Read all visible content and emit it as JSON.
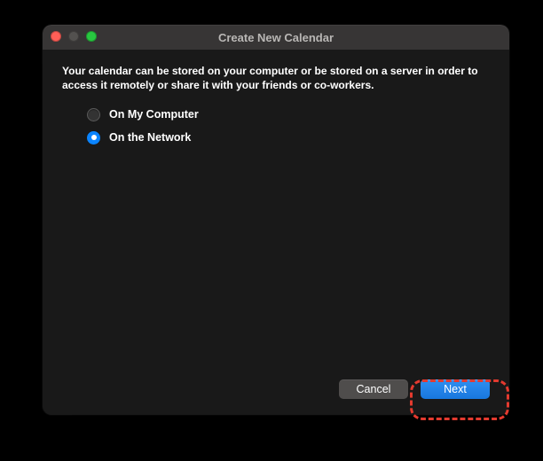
{
  "window": {
    "title": "Create New Calendar"
  },
  "intro": "Your calendar can be stored on your computer or be stored on a server in order to access it remotely or share it with your friends or co-workers.",
  "options": {
    "local": {
      "label": "On My Computer",
      "selected": false
    },
    "network": {
      "label": "On the Network",
      "selected": true
    }
  },
  "buttons": {
    "cancel": "Cancel",
    "next": "Next"
  },
  "annotation": {
    "highlight_target": "next-button"
  }
}
